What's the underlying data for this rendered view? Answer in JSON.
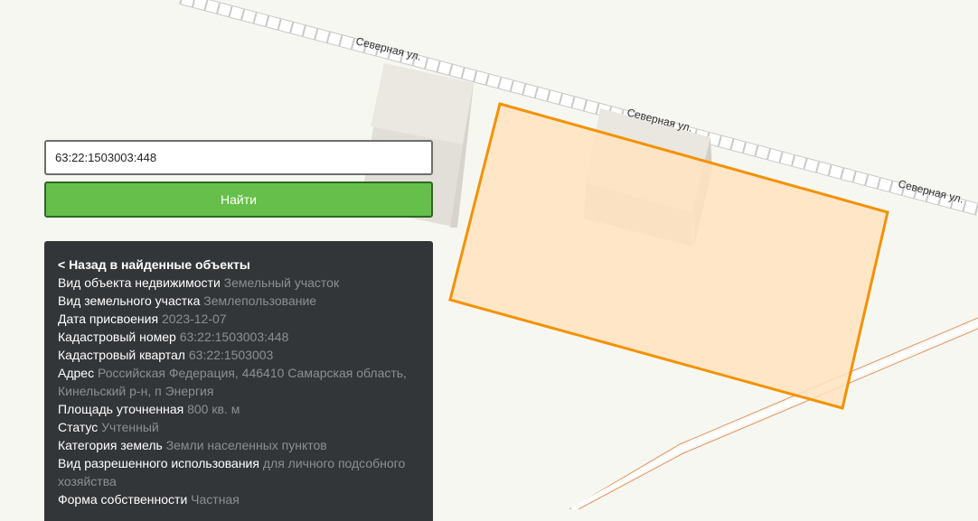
{
  "map": {
    "street_labels": [
      "Северная ул.",
      "Северная ул.",
      "Северная ул."
    ]
  },
  "search": {
    "value": "63:22:1503003:448",
    "button_label": "Найти"
  },
  "info": {
    "back_link": "< Назад в найденные объекты",
    "rows": [
      {
        "key": "Вид объекта недвижимости",
        "value": "Земельный участок"
      },
      {
        "key": "Вид земельного участка",
        "value": "Землепользование"
      },
      {
        "key": "Дата присвоения",
        "value": "2023-12-07"
      },
      {
        "key": "Кадастровый номер",
        "value": "63:22:1503003:448"
      },
      {
        "key": "Кадастровый квартал",
        "value": "63:22:1503003"
      },
      {
        "key": "Адрес",
        "value": "Российская Федерация, 446410 Самарская область, Кинельский р-н, п Энергия"
      },
      {
        "key": "Площадь уточненная",
        "value": "800 кв. м"
      },
      {
        "key": "Статус",
        "value": "Учтенный"
      },
      {
        "key": "Категория земель",
        "value": "Земли населенных пунктов"
      },
      {
        "key": "Вид разрешенного использования",
        "value": "для личного подсобного хозяйства"
      },
      {
        "key": "Форма собственности",
        "value": "Частная"
      }
    ]
  },
  "colors": {
    "parcel_fill": "#ffe3bf",
    "parcel_stroke": "#f39200",
    "search_button": "#66bf4a",
    "panel_bg": "#333639"
  }
}
